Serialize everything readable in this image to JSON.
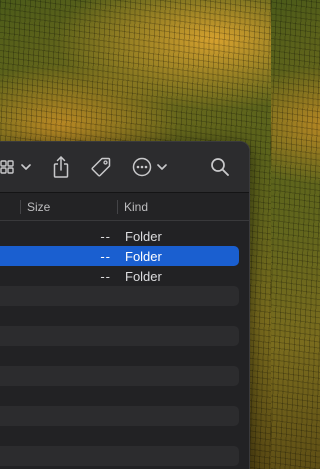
{
  "finder": {
    "columns": {
      "size": "Size",
      "kind": "Kind"
    },
    "rows": [
      {
        "size": "--",
        "kind": "Folder",
        "selected": false
      },
      {
        "size": "--",
        "kind": "Folder",
        "selected": true
      },
      {
        "size": "--",
        "kind": "Folder",
        "selected": false
      }
    ],
    "toolbar_icons": [
      "view-grid-icon",
      "chevron-down-icon",
      "share-icon",
      "tag-icon",
      "more-icon",
      "chevron-down-icon",
      "search-icon"
    ],
    "colors": {
      "selection": "#1a5fd0",
      "window": "#222224",
      "toolbar": "#2c2c2e"
    }
  }
}
